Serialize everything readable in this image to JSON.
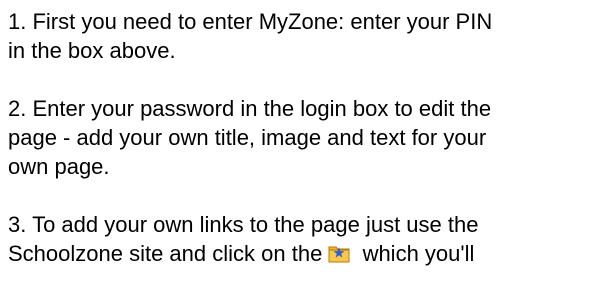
{
  "instructions": {
    "step1": {
      "line1": "1. First you need to enter MyZone: enter your PIN",
      "line2": "in the box above."
    },
    "step2": {
      "line1": "2. Enter your password in the login box to edit the",
      "line2": "page - add your own title, image and text for your",
      "line3": "own page."
    },
    "step3": {
      "line1": "3. To add your own links to the page just use the",
      "line2_before_icon": "Schoolzone site and click on the",
      "line2_after_icon": "which you'll",
      "icon": "folder-icon",
      "icon_colors": {
        "folder": "#f2b31e",
        "folder_edge": "#b57a0a",
        "badge": "#2d5fd3"
      }
    }
  }
}
